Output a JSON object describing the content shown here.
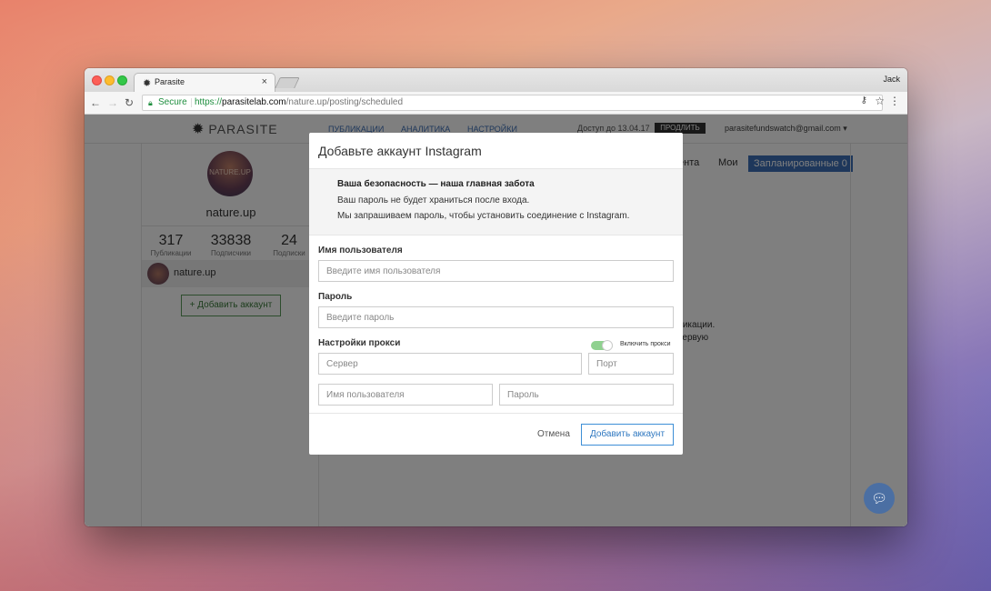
{
  "browser": {
    "tab_title": "Parasite",
    "user": "Jack",
    "secure_label": "Secure",
    "url_scheme": "https://",
    "url_host": "parasitelab.com",
    "url_path": "/nature.up/posting/scheduled"
  },
  "app": {
    "logo_text": "PARASITE",
    "nav": [
      "ПУБЛИКАЦИИ",
      "АНАЛИТИКА",
      "НАСТРОЙКИ"
    ],
    "access_text": "Доступ до 13.04.17",
    "extend_label": "ПРОДЛИТЬ",
    "email": "parasitefundswatch@gmail.com"
  },
  "profile": {
    "avatar_text": "NATURE.UP",
    "name": "nature.up",
    "stats": [
      {
        "value": "317",
        "label": "Публикации"
      },
      {
        "value": "33838",
        "label": "Подписчики"
      },
      {
        "value": "24",
        "label": "Подписки"
      }
    ],
    "account_name": "nature.up",
    "add_account_label": "+ Добавить аккаунт"
  },
  "content_tabs": {
    "partial_tab": "ента",
    "mine": "Мои",
    "scheduled": "Запланированные 0"
  },
  "content_text": {
    "line1": "ликации.",
    "line2": "первую"
  },
  "modal": {
    "title": "Добавьте аккаунт Instagram",
    "notice_head": "Ваша безопасность — наша главная забота",
    "notice_line1": "Ваш пароль не будет храниться после входа.",
    "notice_line2": "Мы запрашиваем пароль, чтобы установить соединение с Instagram.",
    "username_label": "Имя пользователя",
    "username_placeholder": "Введите имя пользователя",
    "password_label": "Пароль",
    "password_placeholder": "Введите пароль",
    "proxy_label": "Настройки прокси",
    "proxy_toggle_label": "Включить прокси",
    "proxy_enabled": true,
    "server_placeholder": "Сервер",
    "port_placeholder": "Порт",
    "proxy_user_placeholder": "Имя пользователя",
    "proxy_pass_placeholder": "Пароль",
    "cancel_label": "Отмена",
    "submit_label": "Добавить аккаунт"
  },
  "colors": {
    "accent": "#3d6fb6",
    "toggle_on": "#8fd18f"
  }
}
